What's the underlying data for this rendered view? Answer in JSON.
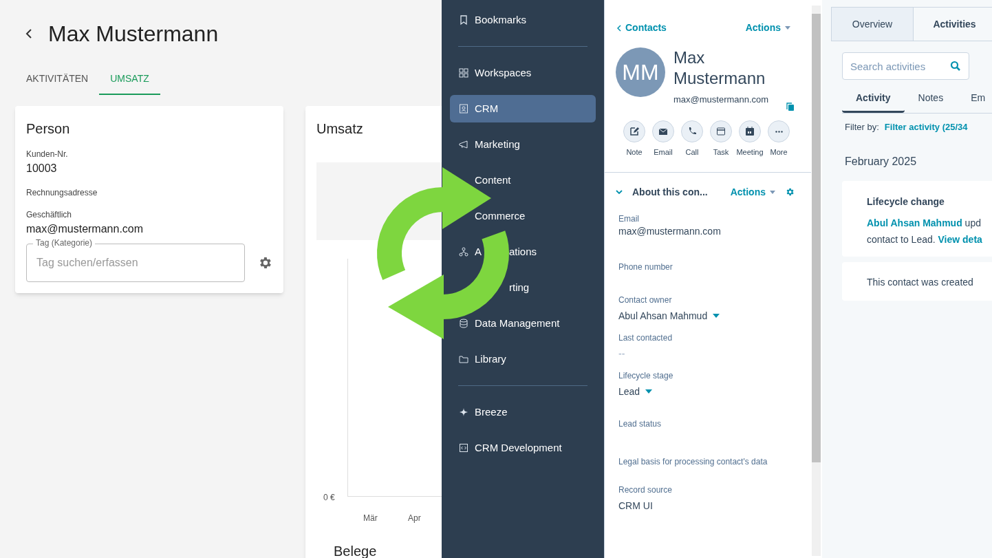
{
  "left_app": {
    "title": "Max Mustermann",
    "tabs": [
      {
        "label": "AKTIVITÄTEN",
        "selected": false
      },
      {
        "label": "UMSATZ",
        "selected": true
      }
    ],
    "person_card": {
      "title": "Person",
      "fields": [
        {
          "label": "Kunden-Nr.",
          "value": "10003"
        },
        {
          "label": "Rechnungsadresse"
        },
        {
          "label": "Geschäftlich",
          "value": "max@mustermann.com"
        }
      ],
      "tag_field": {
        "label": "Tag (Kategorie)",
        "placeholder": "Tag suchen/erfassen"
      }
    },
    "revenue_card": {
      "title": "Umsatz",
      "y_axis_label": "0 €",
      "x_axis_labels": [
        "Mär",
        "Apr"
      ]
    },
    "next_section_title": "Belege"
  },
  "sidebar": {
    "groups": [
      [
        {
          "label": "Bookmarks",
          "selected": false
        }
      ],
      [
        {
          "label": "Workspaces",
          "selected": false
        },
        {
          "label": "CRM",
          "selected": true
        },
        {
          "label": "Marketing",
          "selected": false
        },
        {
          "label": "Content",
          "selected": false
        },
        {
          "label": "Commerce",
          "selected": false
        },
        {
          "label_start": "A",
          "label_end": "ations",
          "selected": false
        },
        {
          "label_end": "rting",
          "selected": false
        },
        {
          "label": "Data Management",
          "selected": false
        },
        {
          "label": "Library",
          "selected": false
        }
      ],
      [
        {
          "label": "Breeze",
          "selected": false
        },
        {
          "label": "CRM Development",
          "selected": false
        }
      ]
    ]
  },
  "contact_panel": {
    "back_link": "Contacts",
    "actions": "Actions",
    "initials": "MM",
    "name": "Max Mustermann",
    "email": "max@mustermann.com",
    "quick_actions": [
      "Note",
      "Email",
      "Call",
      "Task",
      "Meeting",
      "More"
    ],
    "section": {
      "title": "About this con...",
      "actions": "Actions",
      "expanded": true,
      "properties": [
        {
          "label": "Email",
          "value": "max@mustermann.com",
          "dropdown": false
        },
        {
          "label": "Phone number",
          "dropdown": false
        },
        {
          "label": "Contact owner",
          "value": "Abul Ahsan Mahmud",
          "dropdown": true
        },
        {
          "label": "Last contacted",
          "value": "--",
          "dropdown": false
        },
        {
          "label": "Lifecycle stage",
          "value": "Lead",
          "dropdown": true
        },
        {
          "label": "Lead status",
          "dropdown": false
        },
        {
          "label": "Legal basis for processing contact's data",
          "dropdown": false
        },
        {
          "label": "Record source",
          "value": "CRM UI",
          "dropdown": false
        }
      ]
    }
  },
  "activity_panel": {
    "tabs": [
      {
        "label": "Overview",
        "selected": false
      },
      {
        "label": "Activities",
        "selected": true
      }
    ],
    "search": {
      "placeholder": "Search activities"
    },
    "subtabs": [
      {
        "label": "Activity",
        "selected": true
      },
      {
        "label": "Notes",
        "selected": false
      },
      {
        "label": "Em",
        "selected": false
      }
    ],
    "filter_label": "Filter by:",
    "filter_link": "Filter activity (25/34",
    "month": "February 2025",
    "events": [
      {
        "kind": "change",
        "title": "Lifecycle change",
        "actor": "Abul Ahsan Mahmud",
        "text_1": "upd",
        "text_2": "contact to Lead.",
        "link": "View deta"
      },
      {
        "kind": "plain",
        "text_1": "This contact was created"
      }
    ]
  }
}
